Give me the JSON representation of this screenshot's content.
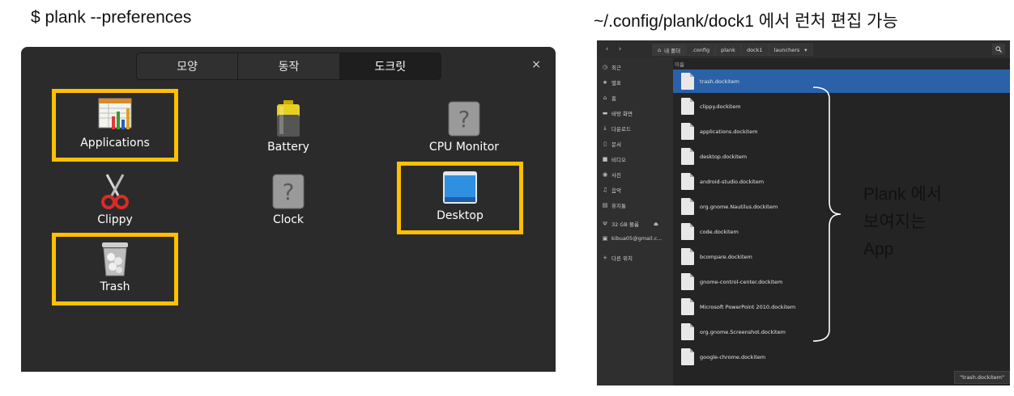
{
  "captions": {
    "left": "$ plank --preferences",
    "right": "~/.config/plank/dock1 에서 런처 편집 가능"
  },
  "plank_window": {
    "tabs": [
      "모양",
      "동작",
      "도크릿"
    ],
    "active_tab": 2,
    "close_label": "×",
    "items": [
      {
        "label": "Applications",
        "icon": "applications-icon",
        "highlighted": true
      },
      {
        "label": "Battery",
        "icon": "battery-icon",
        "highlighted": false
      },
      {
        "label": "CPU Monitor",
        "icon": "unknown-icon",
        "highlighted": false
      },
      {
        "label": "Clippy",
        "icon": "scissors-icon",
        "highlighted": false
      },
      {
        "label": "Clock",
        "icon": "unknown-icon",
        "highlighted": false
      },
      {
        "label": "Desktop",
        "icon": "desktop-icon",
        "highlighted": true
      },
      {
        "label": "Trash",
        "icon": "trash-icon",
        "highlighted": true
      }
    ],
    "highlight_color": "#ffc000"
  },
  "file_manager": {
    "nav": {
      "back": "‹",
      "forward": "›"
    },
    "breadcrumbs": [
      "내 폴더",
      ".config",
      "plank",
      "dock1",
      "launchers"
    ],
    "breadcrumb_menu": "▾",
    "search_icon": "search-icon",
    "sidebar": [
      {
        "label": "최근",
        "icon": "clock-icon",
        "glyph": "◷"
      },
      {
        "label": "별표",
        "icon": "star-icon",
        "glyph": "★"
      },
      {
        "label": "홈",
        "icon": "home-icon",
        "glyph": "⌂"
      },
      {
        "label": "바탕 화면",
        "icon": "folder-icon",
        "glyph": "▬"
      },
      {
        "label": "다운로드",
        "icon": "download-icon",
        "glyph": "↓"
      },
      {
        "label": "문서",
        "icon": "document-icon",
        "glyph": "▯"
      },
      {
        "label": "비디오",
        "icon": "video-icon",
        "glyph": "■"
      },
      {
        "label": "사진",
        "icon": "camera-icon",
        "glyph": "◉"
      },
      {
        "label": "음악",
        "icon": "music-icon",
        "glyph": "♫"
      },
      {
        "label": "휴지통",
        "icon": "trash-icon",
        "glyph": "▤"
      },
      {
        "label": "32 GB 볼륨",
        "icon": "usb-icon",
        "glyph": "Ψ",
        "extra": "⏏"
      },
      {
        "label": "kibua05@gmail.c...",
        "icon": "account-icon",
        "glyph": "▣"
      },
      {
        "label": "다른 위치",
        "icon": "plus-icon",
        "glyph": "+"
      }
    ],
    "column_header": "이름",
    "files": [
      "trash.dockitem",
      "clippy.dockitem",
      "applications.dockitem",
      "desktop.dockitem",
      "android-studio.dockitem",
      "org.gnome.Nautilus.dockitem",
      "code.dockitem",
      "bcompare.dockitem",
      "gnome-control-center.dockitem",
      "Microsoft PowerPoint 2010.dockitem",
      "org.gnome.Screenshot.dockitem",
      "google-chrome.dockitem"
    ],
    "selected_index": 0,
    "status": "\"trash.dockitem\""
  },
  "annotation": {
    "lines": [
      "Plank 에서",
      "보여지는",
      "App"
    ]
  }
}
